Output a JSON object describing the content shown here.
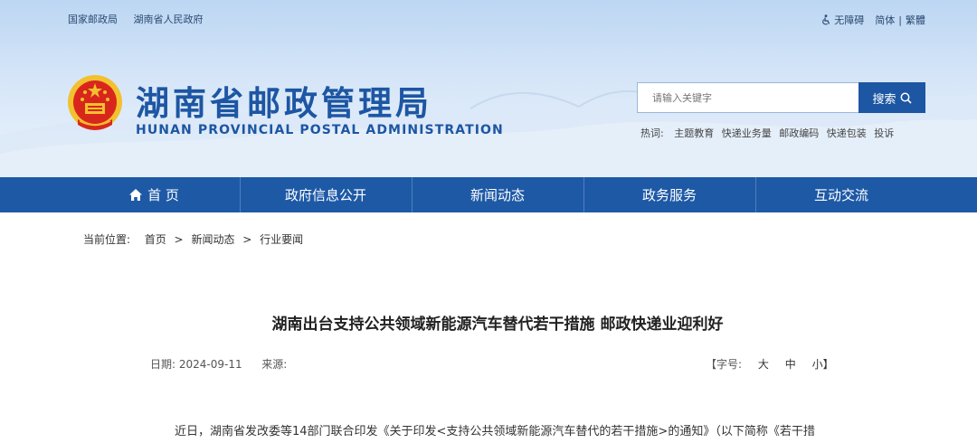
{
  "top_links": [
    "国家邮政局",
    "湖南省人民政府"
  ],
  "top_right": {
    "accessibility": "无障碍",
    "simplified": "简体",
    "separator": "|",
    "traditional": "繁體"
  },
  "site": {
    "title": "湖南省邮政管理局",
    "subtitle": "HUNAN PROVINCIAL POSTAL ADMINISTRATION"
  },
  "search": {
    "placeholder": "请输入关键字",
    "button_label": "搜索"
  },
  "hotwords": {
    "label": "热词:",
    "items": [
      "主题教育",
      "快递业务量",
      "邮政编码",
      "快递包装",
      "投诉"
    ]
  },
  "nav": [
    "首 页",
    "政府信息公开",
    "新闻动态",
    "政务服务",
    "互动交流"
  ],
  "breadcrumb": {
    "label": "当前位置:",
    "items": [
      "首页",
      "新闻动态",
      "行业要闻"
    ],
    "separator": ">"
  },
  "article": {
    "title": "湖南出台支持公共领域新能源汽车替代若干措施 邮政快递业迎利好",
    "date_label": "日期:",
    "date": "2024-09-11",
    "source_label": "来源:",
    "font_size_label": "【字号:",
    "font_sizes": [
      "大",
      "中",
      "小】"
    ],
    "first_paragraph": "近日，湖南省发改委等14部门联合印发《关于印发<支持公共领域新能源汽车替代的若干措施>的通知》（以下简称《若干措"
  },
  "colors": {
    "brand_blue": "#1d56a3",
    "nav_blue": "#1e59a6",
    "emblem_red": "#d9261c",
    "emblem_gold": "#f2c12e"
  },
  "icons": [
    "accessibility-icon",
    "search-icon",
    "home-icon",
    "national-emblem"
  ]
}
